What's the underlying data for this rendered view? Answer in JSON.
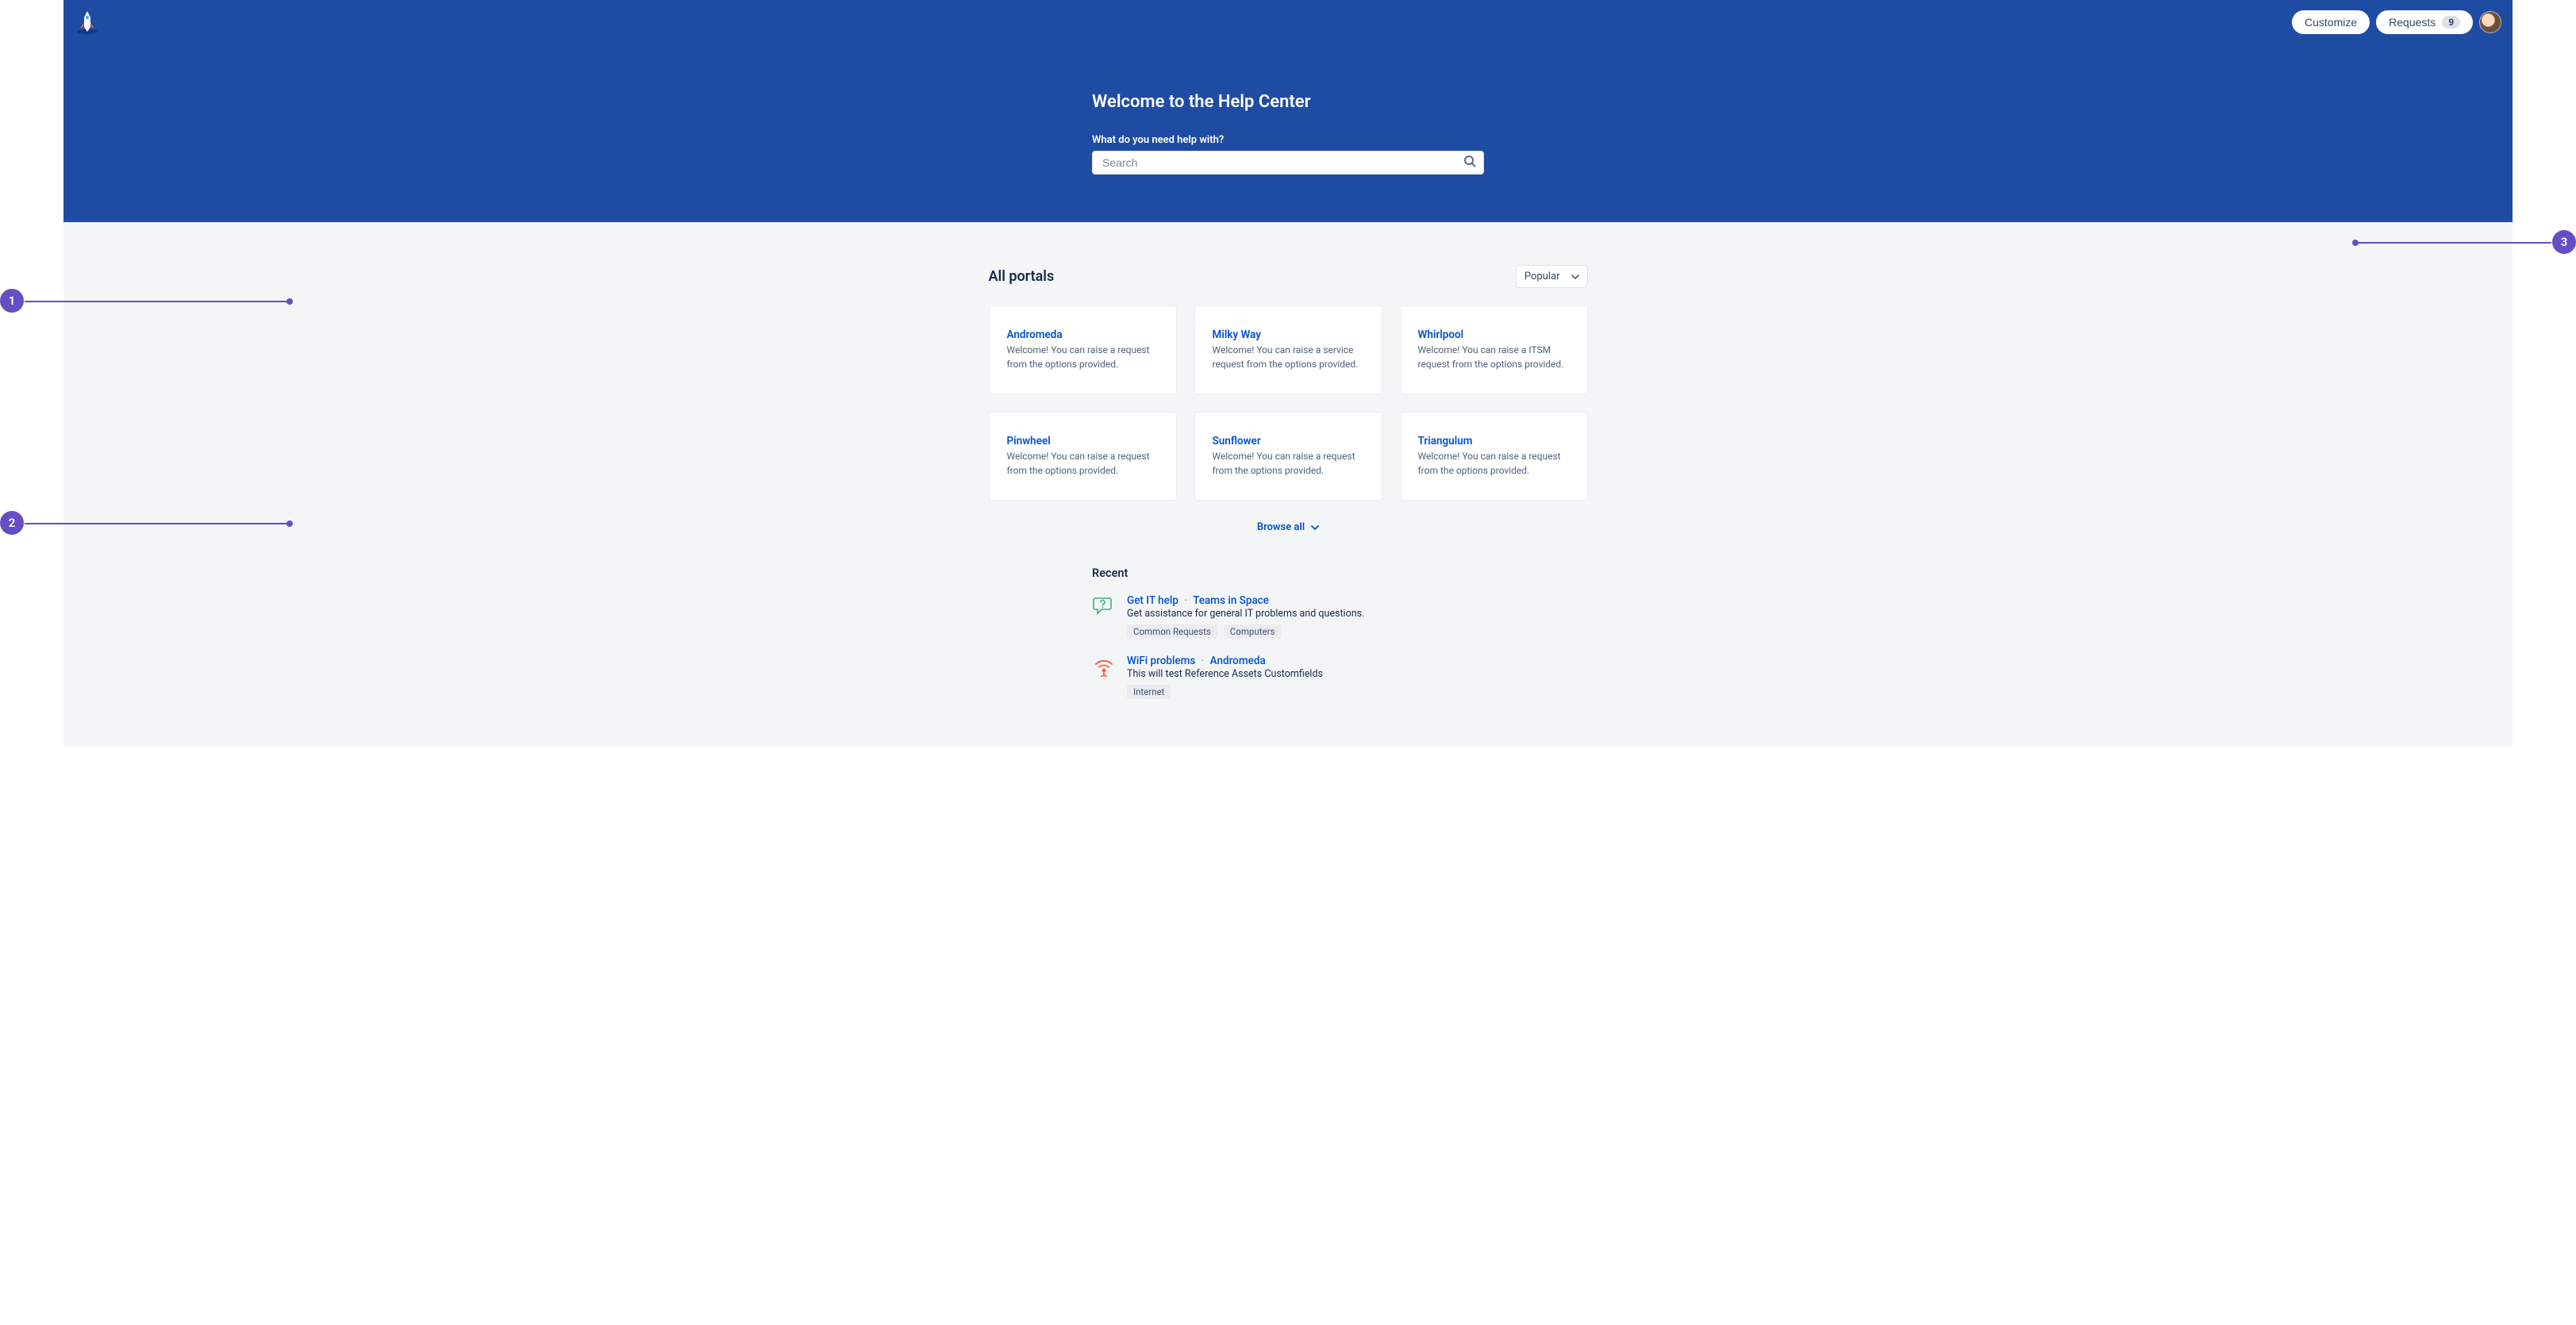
{
  "header": {
    "customize_label": "Customize",
    "requests_label": "Requests",
    "requests_count": "9"
  },
  "hero": {
    "title": "Welcome to the Help Center",
    "search_label": "What do you need help with?",
    "search_placeholder": "Search"
  },
  "portals": {
    "heading": "All portals",
    "sort_label": "Popular",
    "browse_all": "Browse all",
    "items": [
      {
        "title": "Andromeda",
        "desc": "Welcome! You can raise a request from the options provided."
      },
      {
        "title": "Milky Way",
        "desc": "Welcome! You can raise a service request from the options provided."
      },
      {
        "title": "Whirlpool",
        "desc": "Welcome! You can raise a ITSM request from the options provided."
      },
      {
        "title": "Pinwheel",
        "desc": "Welcome! You can raise a request from the options provided."
      },
      {
        "title": "Sunflower",
        "desc": "Welcome! You can raise a request from the options provided."
      },
      {
        "title": "Triangulum",
        "desc": "Welcome! You can raise a request from the options provided."
      }
    ]
  },
  "recent": {
    "heading": "Recent",
    "items": [
      {
        "title": "Get IT help",
        "portal": "Teams in Space",
        "desc": "Get assistance for general IT problems and questions.",
        "tags": [
          "Common Requests",
          "Computers"
        ]
      },
      {
        "title": "WiFi problems",
        "portal": "Andromeda",
        "desc": "This will test Reference Assets Customfields",
        "tags": [
          "Internet"
        ]
      }
    ]
  },
  "callouts": {
    "one": "1",
    "two": "2",
    "three": "3"
  }
}
